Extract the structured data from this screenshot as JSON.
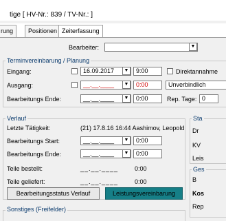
{
  "window": {
    "title": "tige [ HV-Nr.: 839 / TV-Nr.:  ]"
  },
  "tabs": [
    {
      "label": "rung"
    },
    {
      "label": "Positionen"
    },
    {
      "label": "Zeiterfassung"
    }
  ],
  "bearbeiter": {
    "label": "Bearbeiter:",
    "value": ""
  },
  "termin": {
    "title": "Terminvereinbarung / Planung",
    "eingang_label": "Eingang:",
    "eingang_date": "16.09.2017",
    "eingang_time": "9:00",
    "ausgang_label": "Ausgang:",
    "ausgang_date": "__.__.____",
    "ausgang_time": "0:00",
    "ende_label": "Bearbeitungs Ende:",
    "ende_date": "__.__.____",
    "ende_time": "0:00",
    "direktannahme_label": "Direktannahme",
    "unverbindlich": "Unverbindlich",
    "rep_tage_label": "Rep. Tage:",
    "rep_tage_value": "0"
  },
  "verlauf": {
    "title": "Verlauf",
    "letzte_label": "Letzte Tätigkeit:",
    "letzte_value": "(21) 17.8.16 16:44 Aashimov, Leopold",
    "start_label": "Bearbeitungs Start:",
    "start_date": "__.__.____",
    "start_time": "0:00",
    "ende_label": "Bearbeitungs Ende:",
    "ende_date": "__.__.____",
    "ende_time": "0:00",
    "bestellt_label": "Teile bestellt:",
    "bestellt_date": "__.__.____",
    "bestellt_time": "0:00",
    "geliefert_label": "Teile geliefert:",
    "geliefert_date": "__.__.____",
    "geliefert_time": "0:00",
    "btn_status": "Bearbeitungsstatus Verlauf",
    "btn_leistung": "Leistungsvereinbarung"
  },
  "sonstiges": {
    "title": "Sonstiges (Freifelder)"
  },
  "right_panel": {
    "sta": "Sta",
    "dr": "Dr",
    "kv": "KV",
    "leis": "Leis",
    "ges": "Ges",
    "b": "B",
    "kos": "Kos",
    "rep": "Rep"
  },
  "colors": {
    "accent": "#167f87",
    "group_title": "#0b3b6e",
    "error": "#d00000"
  }
}
